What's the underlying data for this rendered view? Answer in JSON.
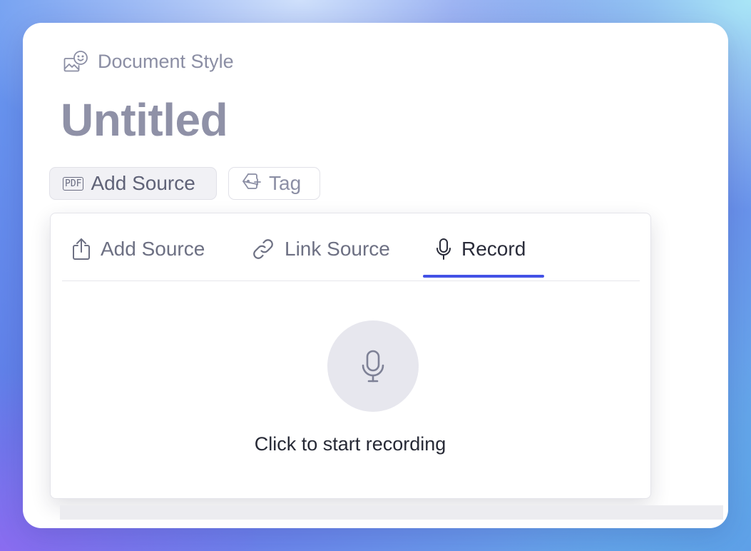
{
  "header": {
    "style_label": "Document Style",
    "title": "Untitled"
  },
  "chips": {
    "add_source_label": "Add Source",
    "pdf_glyph": "PDF",
    "tag_label": "Tag"
  },
  "popover": {
    "tabs": [
      {
        "label": "Add Source",
        "icon": "upload-icon",
        "active": false
      },
      {
        "label": "Link Source",
        "icon": "link-icon",
        "active": false
      },
      {
        "label": "Record",
        "icon": "microphone-icon",
        "active": true
      }
    ],
    "record_hint": "Click to start recording"
  },
  "colors": {
    "accent": "#4352e6",
    "title_text": "#8f91a7",
    "muted_text": "#8b8ea4",
    "mic_circle": "#e7e7ee"
  }
}
